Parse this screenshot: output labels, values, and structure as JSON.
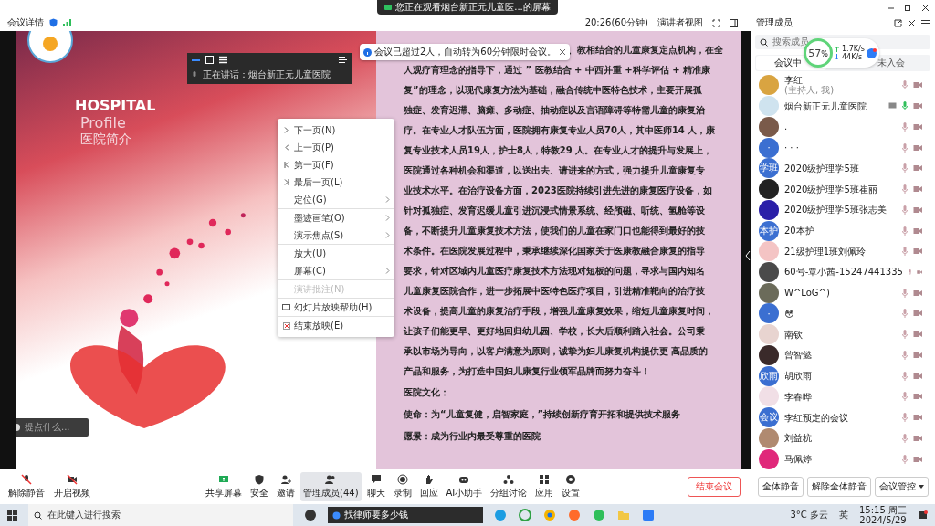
{
  "banner": {
    "text": "您正在观看烟台新正元儿童医...的屏幕"
  },
  "header": {
    "meeting_details": "会议详情",
    "timer": "20:26(60分钟)",
    "view": "演讲者视图",
    "panel_title": "管理成员"
  },
  "toast": {
    "text": "会议已超过2人，自动转为60分钟限时会议。"
  },
  "speaker_bar": {
    "text": "正在讲话：烟台新正元儿童医院"
  },
  "slide": {
    "title_en": "HOSPITAL",
    "subtitle_en": "Profile",
    "title_cn": "医院简介",
    "paragraph_lines": [
      "、教相结合的儿童康复定点机构，在全",
      "人观疗育理念的指导下，通过 ” 医教结合 + 中西并重 +科学评估 + 精准康",
      "复”的理念，以现代康复方法为基础，融合传统中医特色技术，主要开展孤",
      "独症、发育迟滞、脑瘫、多动症、抽动症以及言语障碍等特需儿童的康复治",
      "疗。在专业人才队伍方面，医院拥有康复专业人员70人，其中医师14 人，康",
      "复专业技术人员19人，护士8人，特教29 人。在专业人才的提升与发展上，",
      "医院通过各种机会和渠道，以送出去、请进来的方式，强力提升儿童康复专",
      "业技术水平。在治疗设备方面，2023医院持续引进先进的康复医疗设备，如",
      "针对孤独症、发育迟缓儿童引进沉浸式情景系统、经颅磁、听统、氢舱等设",
      "备，不断提升儿童康复技术方法，使我们的儿童在家门口也能得到最好的技",
      "术条件。在医院发展过程中，秉承继续深化国家关于医康教融合康复的指导",
      "要求，针对区域内儿童医疗康复技术方法现对短板的问题，寻求与国内知名",
      "儿童康复医院合作，进一步拓展中医特色医疗项目，引进精准靶向的治疗技",
      "术设备，提高儿童的康复治疗手段，增强儿童康复效果，缩短儿童康复时间，",
      "让孩子们能更早、更好地回归幼儿园、学校，长大后顺利踏入社会。公司秉",
      "承以市场为导向，以客户满意为原则，诚挚为妇儿康复机构提供更 高品质的",
      "产品和服务，为打造中国妇儿康复行业领军品牌而努力奋斗！"
    ],
    "culture_lines": [
      "医院文化：",
      "使命：为“儿童复健，启智家庭，”持续创新疗育开拓和提供技术服务",
      "愿景：成为行业内最受尊重的医院"
    ],
    "input_hint": "提点什么..."
  },
  "context_menu": [
    {
      "kind": "next",
      "label": "下一页(N)",
      "submenu": false,
      "disabled": false,
      "divider_after": false
    },
    {
      "kind": "prev",
      "label": "上一页(P)",
      "submenu": false,
      "disabled": false,
      "divider_after": false
    },
    {
      "kind": "first",
      "label": "第一页(F)",
      "submenu": false,
      "disabled": false,
      "divider_after": false
    },
    {
      "kind": "last",
      "label": "最后一页(L)",
      "submenu": false,
      "disabled": false,
      "divider_after": false
    },
    {
      "kind": "plain",
      "label": "定位(G)",
      "submenu": true,
      "disabled": false,
      "divider_after": true
    },
    {
      "kind": "plain",
      "label": "墨迹画笔(O)",
      "submenu": true,
      "disabled": false,
      "divider_after": false
    },
    {
      "kind": "plain",
      "label": "演示焦点(S)",
      "submenu": true,
      "disabled": false,
      "divider_after": true
    },
    {
      "kind": "plain",
      "label": "放大(U)",
      "submenu": false,
      "disabled": false,
      "divider_after": false
    },
    {
      "kind": "plain",
      "label": "屏幕(C)",
      "submenu": true,
      "disabled": false,
      "divider_after": true
    },
    {
      "kind": "plain",
      "label": "演讲批注(N)",
      "submenu": false,
      "disabled": true,
      "divider_after": true
    },
    {
      "kind": "help",
      "label": "幻灯片放映帮助(H)",
      "submenu": false,
      "disabled": false,
      "divider_after": true
    },
    {
      "kind": "end",
      "label": "结束放映(E)",
      "submenu": false,
      "disabled": false,
      "divider_after": false
    }
  ],
  "panel": {
    "search_placeholder": "搜索成员",
    "network": {
      "percent": "57",
      "unit": "%",
      "up": "1.7K/s",
      "down": "44K/s"
    },
    "tabs": [
      {
        "label": "会议中",
        "selected": true
      },
      {
        "label": "未入会",
        "selected": false
      }
    ],
    "members": [
      {
        "name": "李红",
        "note": "(主持人, 我)",
        "kind": "photo",
        "color": "#d9a441",
        "sharing": false,
        "speaking": false
      },
      {
        "name": "烟台新正元儿童医院",
        "kind": "photo",
        "color": "#cfe3ef",
        "sharing": true,
        "speaking": true
      },
      {
        "name": ".",
        "kind": "photo",
        "color": "#7a5a4a",
        "sharing": false,
        "speaking": false
      },
      {
        "name": "· · ·",
        "kind": "initial",
        "avatar_text": "·",
        "color": "#3b6fd1",
        "sharing": false,
        "speaking": false
      },
      {
        "name": "2020级护理学5班",
        "kind": "initial",
        "avatar_text": "学班",
        "color": "#3b6fd1",
        "sharing": false,
        "speaking": false
      },
      {
        "name": "2020级护理学5班崔丽",
        "kind": "photo",
        "color": "#222222",
        "sharing": false,
        "speaking": false
      },
      {
        "name": "2020级护理学5班张志美",
        "kind": "photo",
        "color": "#2a1fa8",
        "sharing": false,
        "speaking": false
      },
      {
        "name": "20本护",
        "kind": "initial",
        "avatar_text": "本护",
        "color": "#3b6fd1",
        "sharing": false,
        "speaking": false
      },
      {
        "name": "21级护理1班刘佩玲",
        "kind": "photo",
        "color": "#f4c4c4",
        "sharing": false,
        "speaking": false
      },
      {
        "name": "60号-覃小茜-15247441335",
        "kind": "photo",
        "color": "#4a4a4a",
        "sharing": false,
        "speaking": false
      },
      {
        "name": "W^LoG^)",
        "kind": "photo",
        "color": "#6b6b5a",
        "sharing": false,
        "speaking": false
      },
      {
        "name": "😳",
        "kind": "initial",
        "avatar_text": "·",
        "color": "#3b6fd1",
        "sharing": false,
        "speaking": false
      },
      {
        "name": "南钦",
        "kind": "photo",
        "color": "#e8d4d0",
        "sharing": false,
        "speaking": false
      },
      {
        "name": "曾智懿",
        "kind": "photo",
        "color": "#3a2a2a",
        "sharing": false,
        "speaking": false
      },
      {
        "name": "胡欣雨",
        "kind": "initial",
        "avatar_text": "欣雨",
        "color": "#3b6fd1",
        "sharing": false,
        "speaking": false
      },
      {
        "name": "李春晔",
        "kind": "photo",
        "color": "#f1dfe6",
        "sharing": false,
        "speaking": false
      },
      {
        "name": "李红预定的会议",
        "kind": "initial",
        "avatar_text": "会议",
        "color": "#3b6fd1",
        "sharing": false,
        "speaking": false
      },
      {
        "name": "刘益杭",
        "kind": "photo",
        "color": "#b08a70",
        "sharing": false,
        "speaking": false
      },
      {
        "name": "马佩婷",
        "kind": "photo",
        "color": "#e0287a",
        "sharing": false,
        "speaking": false
      }
    ],
    "buttons": [
      "全体静音",
      "解除全体静音",
      "会议管控"
    ]
  },
  "toolbar": {
    "left": [
      {
        "kind": "mic",
        "label": "解除静音"
      },
      {
        "kind": "video",
        "label": "开启视频"
      }
    ],
    "center": [
      {
        "kind": "share",
        "label": "共享屏幕",
        "selected": false
      },
      {
        "kind": "shield",
        "label": "安全",
        "selected": false
      },
      {
        "kind": "invite",
        "label": "邀请",
        "selected": false
      },
      {
        "kind": "members",
        "label": "管理成员(44)",
        "selected": true
      },
      {
        "kind": "chat",
        "label": "聊天",
        "selected": false
      },
      {
        "kind": "record",
        "label": "录制",
        "selected": false
      },
      {
        "kind": "react",
        "label": "回应",
        "selected": false
      },
      {
        "kind": "ai",
        "label": "AI小助手",
        "selected": false
      },
      {
        "kind": "group",
        "label": "分组讨论",
        "selected": false
      },
      {
        "kind": "apps",
        "label": "应用",
        "selected": false
      },
      {
        "kind": "settings",
        "label": "设置",
        "selected": false
      }
    ],
    "end_button": "结束会议"
  },
  "taskbar": {
    "search_placeholder": "在此键入进行搜索",
    "browser_search": "找律师要多少钱",
    "weather": "3°C 多云",
    "ime": "英",
    "time": "15:15 周三",
    "date": "2024/5/29"
  }
}
